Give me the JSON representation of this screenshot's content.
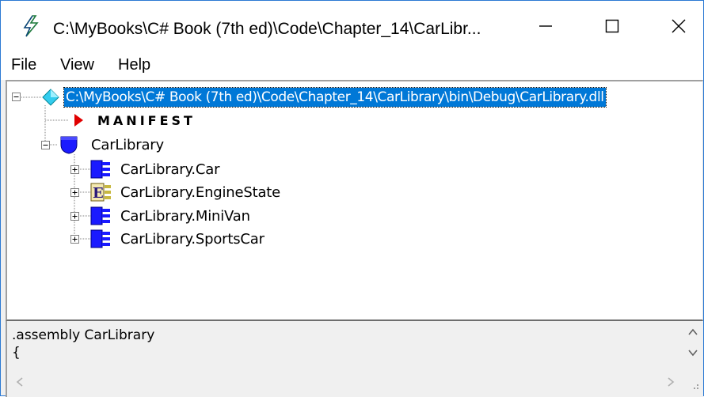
{
  "window": {
    "title": "C:\\MyBooks\\C# Book (7th ed)\\Code\\Chapter_14\\CarLibr...",
    "app_icon": "lightning-pen-icon",
    "controls": {
      "minimize": "minimize-icon",
      "maximize": "maximize-icon",
      "close": "close-icon"
    }
  },
  "menu": {
    "items": [
      {
        "label": "File"
      },
      {
        "label": "View"
      },
      {
        "label": "Help"
      }
    ]
  },
  "tree": {
    "root": {
      "label": "C:\\MyBooks\\C# Book (7th ed)\\Code\\Chapter_14\\CarLibrary\\bin\\Debug\\CarLibrary.dll",
      "icon": "assembly-diamond-icon",
      "selected": true
    },
    "manifest": {
      "label": "MANIFEST",
      "icon": "manifest-arrow-icon"
    },
    "namespace": {
      "label": "CarLibrary",
      "icon": "namespace-shield-icon"
    },
    "types": [
      {
        "label": "CarLibrary.Car",
        "icon": "class-icon"
      },
      {
        "label": "CarLibrary.EngineState",
        "icon": "enum-icon"
      },
      {
        "label": "CarLibrary.MiniVan",
        "icon": "class-icon"
      },
      {
        "label": "CarLibrary.SportsCar",
        "icon": "class-icon"
      }
    ]
  },
  "code": {
    "lines": [
      ".assembly CarLibrary",
      "{"
    ]
  },
  "colors": {
    "selection": "#0078d7",
    "class_icon": "#1a1aff",
    "manifest_arrow": "#e00000",
    "window_border": "#2b79d3"
  }
}
